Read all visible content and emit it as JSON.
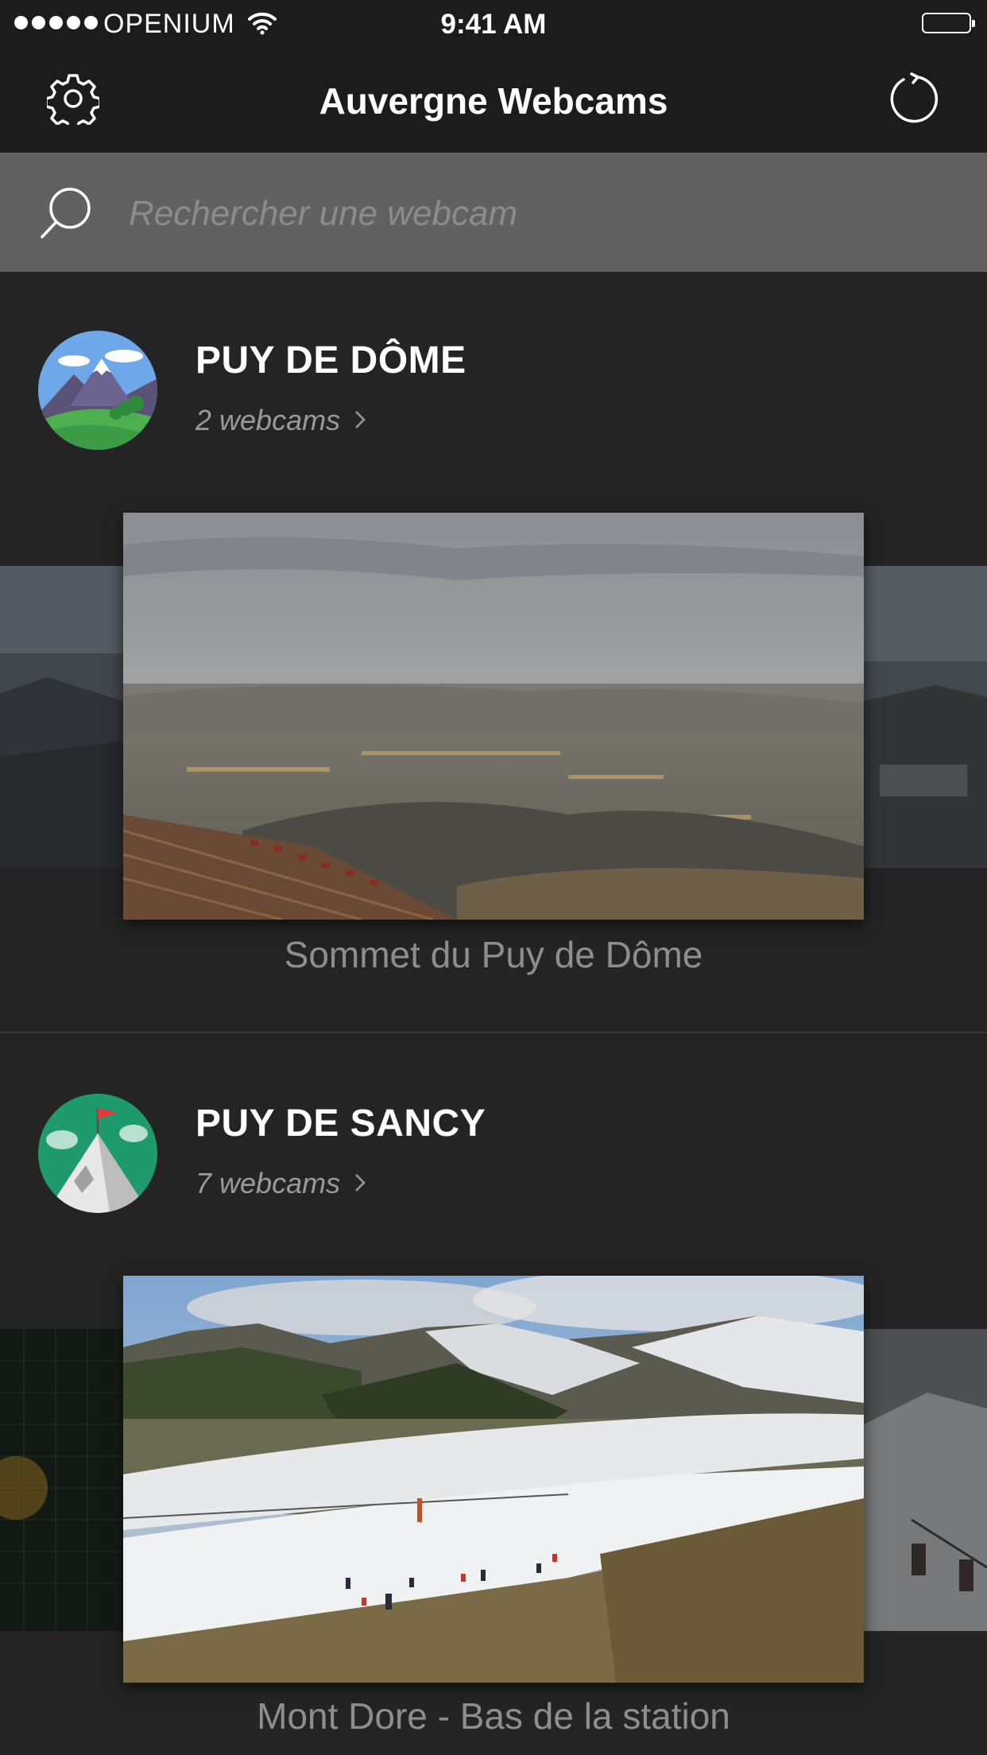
{
  "status_bar": {
    "carrier": "OPENIUM",
    "time": "9:41 AM"
  },
  "nav": {
    "title": "Auvergne Webcams",
    "left_icon": "gear-icon",
    "right_icon": "refresh-icon"
  },
  "search": {
    "placeholder": "Rechercher une webcam",
    "value": ""
  },
  "regions": [
    {
      "name": "PUY DE DÔME",
      "count_label": "2 webcams",
      "webcam_caption": "Sommet du Puy de Dôme"
    },
    {
      "name": "PUY DE SANCY",
      "count_label": "7 webcams",
      "webcam_caption": "Mont Dore - Bas de la station"
    }
  ]
}
